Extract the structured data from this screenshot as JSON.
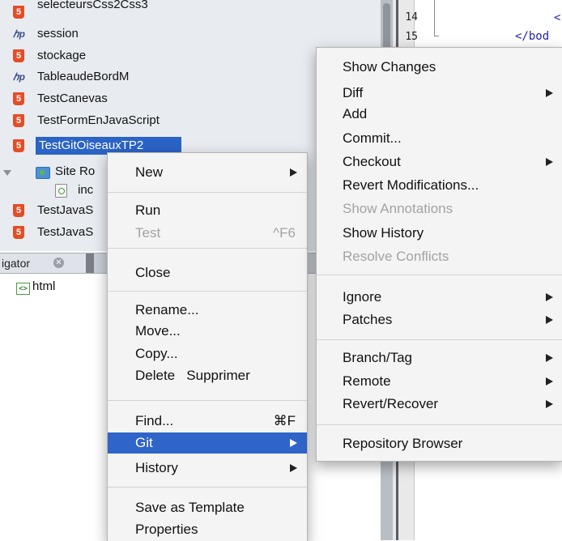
{
  "project_tree": {
    "items": [
      {
        "label": "selecteursCss2Css3",
        "icon": "html5-icon"
      },
      {
        "label": "session",
        "icon": "php-icon"
      },
      {
        "label": "stockage",
        "icon": "html5-icon"
      },
      {
        "label": "TableaudeBordM",
        "icon": "php-icon"
      },
      {
        "label": "TestCanevas",
        "icon": "html5-icon"
      },
      {
        "label": "TestFormEnJavaScript",
        "icon": "html5-icon"
      },
      {
        "label": "TestGitOiseauxTP2",
        "icon": "html5-icon",
        "selected": true
      },
      {
        "label": "Site Ro",
        "icon": "folder-icon"
      },
      {
        "label": "inc",
        "icon": "html-file-icon"
      },
      {
        "label": "TestJavaS",
        "icon": "html5-icon"
      },
      {
        "label": "TestJavaS",
        "icon": "html5-icon"
      }
    ],
    "php_glyph": "ℎp",
    "html5_glyph": "5"
  },
  "navigator": {
    "tab_label": "igator",
    "close_glyph": "✕",
    "items": [
      {
        "label": "html",
        "icon": "html-tag-icon"
      }
    ],
    "html_glyph": "<>"
  },
  "editor": {
    "line_numbers": [
      "14",
      "15"
    ],
    "lines": [
      "<",
      "</bod"
    ]
  },
  "context_menu": {
    "items": [
      {
        "label": "New",
        "submenu": true
      },
      {
        "label": "Run"
      },
      {
        "label": "Test",
        "shortcut": "^F6",
        "disabled": true
      },
      {
        "label": "Close"
      },
      {
        "label": "Rename..."
      },
      {
        "label": "Move..."
      },
      {
        "label": "Copy..."
      },
      {
        "label": "Delete   Supprimer"
      },
      {
        "label": "Find...",
        "shortcut": "⌘F"
      },
      {
        "label": "Git",
        "submenu": true,
        "highlighted": true
      },
      {
        "label": "History",
        "submenu": true
      },
      {
        "label": "Save as Template"
      },
      {
        "label": "Properties"
      }
    ]
  },
  "git_submenu": {
    "items": [
      {
        "label": "Show Changes"
      },
      {
        "label": "Diff",
        "submenu": true
      },
      {
        "label": "Add"
      },
      {
        "label": "Commit..."
      },
      {
        "label": "Checkout",
        "submenu": true
      },
      {
        "label": "Revert Modifications..."
      },
      {
        "label": "Show Annotations",
        "disabled": true
      },
      {
        "label": "Show History"
      },
      {
        "label": "Resolve Conflicts",
        "disabled": true
      },
      {
        "label": "Ignore",
        "submenu": true
      },
      {
        "label": "Patches",
        "submenu": true
      },
      {
        "label": "Branch/Tag",
        "submenu": true
      },
      {
        "label": "Remote",
        "submenu": true
      },
      {
        "label": "Revert/Recover",
        "submenu": true
      },
      {
        "label": "Repository Browser"
      }
    ]
  },
  "colors": {
    "selection": "#2b63c6",
    "menu_highlight": "#2f64c9",
    "html5_badge": "#e44d26",
    "disabled_text": "#a3a3a3"
  }
}
